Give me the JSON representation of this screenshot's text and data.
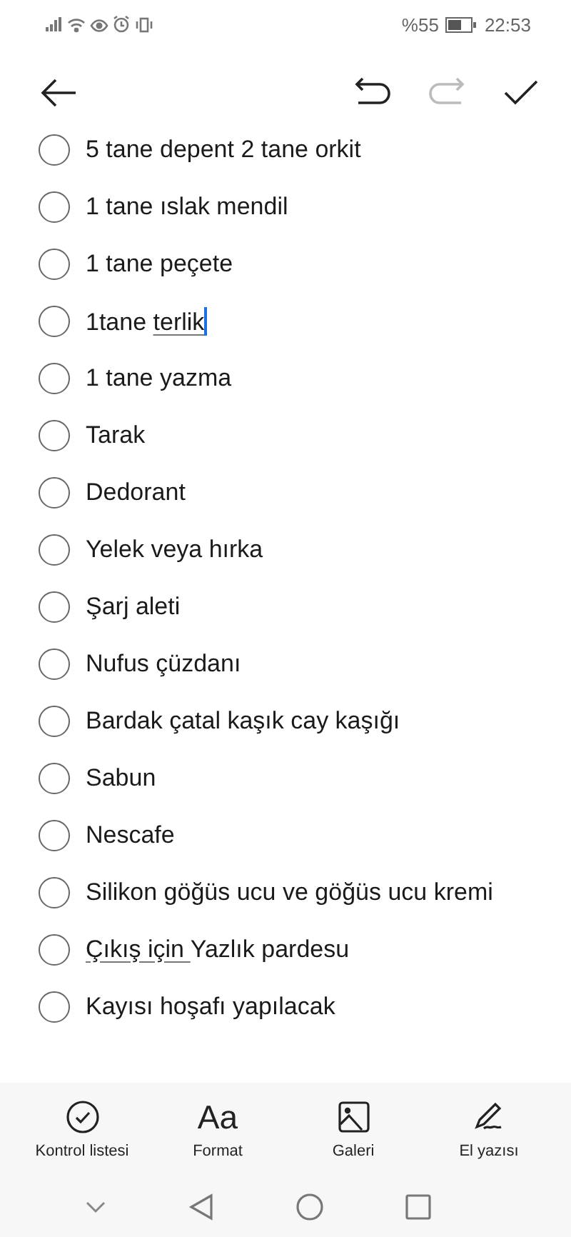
{
  "status_bar": {
    "battery_text": "%55",
    "time": "22:53"
  },
  "toolbar": {
    "redo_disabled": true
  },
  "checklist": [
    {
      "checked": false,
      "cursor": false,
      "segments": [
        {
          "text": "5 tane depent 2 tane orkit",
          "underlined": false
        }
      ]
    },
    {
      "checked": false,
      "cursor": false,
      "segments": [
        {
          "text": "1 tane ıslak mendil",
          "underlined": false
        }
      ]
    },
    {
      "checked": false,
      "cursor": false,
      "segments": [
        {
          "text": "1 tane peçete",
          "underlined": false
        }
      ]
    },
    {
      "checked": false,
      "cursor": true,
      "segments": [
        {
          "text": "1tane ",
          "underlined": false
        },
        {
          "text": "terlik",
          "underlined": true
        }
      ]
    },
    {
      "checked": false,
      "cursor": false,
      "segments": [
        {
          "text": "1 tane yazma",
          "underlined": false
        }
      ]
    },
    {
      "checked": false,
      "cursor": false,
      "segments": [
        {
          "text": "Tarak",
          "underlined": false
        }
      ]
    },
    {
      "checked": false,
      "cursor": false,
      "segments": [
        {
          "text": "Dedorant",
          "underlined": false
        }
      ]
    },
    {
      "checked": false,
      "cursor": false,
      "segments": [
        {
          "text": "Yelek veya hırka",
          "underlined": false
        }
      ]
    },
    {
      "checked": false,
      "cursor": false,
      "segments": [
        {
          "text": "Şarj aleti",
          "underlined": false
        }
      ]
    },
    {
      "checked": false,
      "cursor": false,
      "segments": [
        {
          "text": "Nufus çüzdanı",
          "underlined": false
        }
      ]
    },
    {
      "checked": false,
      "cursor": false,
      "segments": [
        {
          "text": "Bardak çatal kaşık cay kaşığı",
          "underlined": false
        }
      ]
    },
    {
      "checked": false,
      "cursor": false,
      "segments": [
        {
          "text": "Sabun",
          "underlined": false
        }
      ]
    },
    {
      "checked": false,
      "cursor": false,
      "segments": [
        {
          "text": "Nescafe",
          "underlined": false
        }
      ]
    },
    {
      "checked": false,
      "cursor": false,
      "segments": [
        {
          "text": "Silikon göğüs ucu ve göğüs ucu kremi",
          "underlined": false
        }
      ]
    },
    {
      "checked": false,
      "cursor": false,
      "segments": [
        {
          "text": "Çıkış için ",
          "underlined": true
        },
        {
          "text": "Yazlık pardesu",
          "underlined": false
        }
      ]
    },
    {
      "checked": false,
      "cursor": false,
      "segments": [
        {
          "text": "Kayısı hoşafı yapılacak",
          "underlined": false
        }
      ]
    }
  ],
  "bottom_toolbar": [
    {
      "kind": "checklist",
      "label": "Kontrol listesi"
    },
    {
      "kind": "format",
      "icon_text": "Aa",
      "label": "Format"
    },
    {
      "kind": "gallery",
      "label": "Galeri"
    },
    {
      "kind": "handwriting",
      "label": "El yazısı"
    }
  ]
}
